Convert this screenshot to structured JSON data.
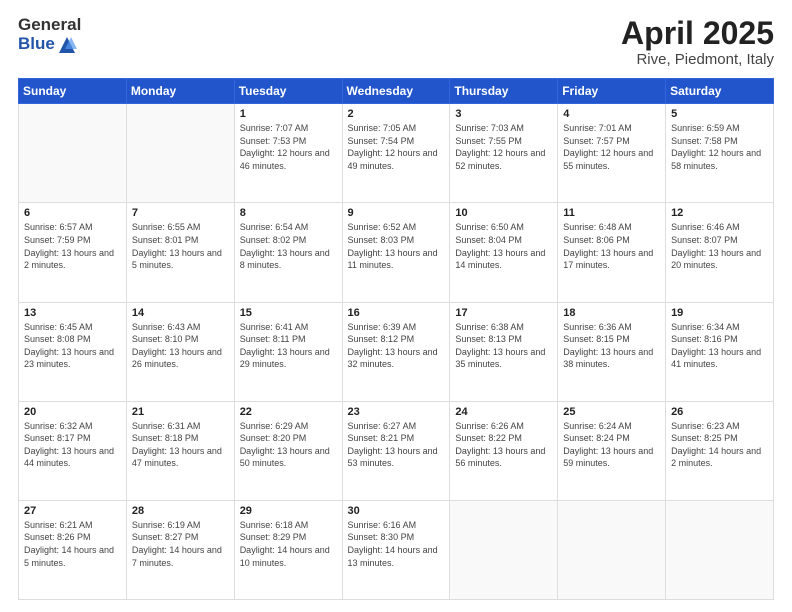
{
  "header": {
    "logo_general": "General",
    "logo_blue": "Blue",
    "title": "April 2025",
    "subtitle": "Rive, Piedmont, Italy"
  },
  "weekdays": [
    "Sunday",
    "Monday",
    "Tuesday",
    "Wednesday",
    "Thursday",
    "Friday",
    "Saturday"
  ],
  "weeks": [
    [
      {
        "day": "",
        "sunrise": "",
        "sunset": "",
        "daylight": ""
      },
      {
        "day": "",
        "sunrise": "",
        "sunset": "",
        "daylight": ""
      },
      {
        "day": "1",
        "sunrise": "Sunrise: 7:07 AM",
        "sunset": "Sunset: 7:53 PM",
        "daylight": "Daylight: 12 hours and 46 minutes."
      },
      {
        "day": "2",
        "sunrise": "Sunrise: 7:05 AM",
        "sunset": "Sunset: 7:54 PM",
        "daylight": "Daylight: 12 hours and 49 minutes."
      },
      {
        "day": "3",
        "sunrise": "Sunrise: 7:03 AM",
        "sunset": "Sunset: 7:55 PM",
        "daylight": "Daylight: 12 hours and 52 minutes."
      },
      {
        "day": "4",
        "sunrise": "Sunrise: 7:01 AM",
        "sunset": "Sunset: 7:57 PM",
        "daylight": "Daylight: 12 hours and 55 minutes."
      },
      {
        "day": "5",
        "sunrise": "Sunrise: 6:59 AM",
        "sunset": "Sunset: 7:58 PM",
        "daylight": "Daylight: 12 hours and 58 minutes."
      }
    ],
    [
      {
        "day": "6",
        "sunrise": "Sunrise: 6:57 AM",
        "sunset": "Sunset: 7:59 PM",
        "daylight": "Daylight: 13 hours and 2 minutes."
      },
      {
        "day": "7",
        "sunrise": "Sunrise: 6:55 AM",
        "sunset": "Sunset: 8:01 PM",
        "daylight": "Daylight: 13 hours and 5 minutes."
      },
      {
        "day": "8",
        "sunrise": "Sunrise: 6:54 AM",
        "sunset": "Sunset: 8:02 PM",
        "daylight": "Daylight: 13 hours and 8 minutes."
      },
      {
        "day": "9",
        "sunrise": "Sunrise: 6:52 AM",
        "sunset": "Sunset: 8:03 PM",
        "daylight": "Daylight: 13 hours and 11 minutes."
      },
      {
        "day": "10",
        "sunrise": "Sunrise: 6:50 AM",
        "sunset": "Sunset: 8:04 PM",
        "daylight": "Daylight: 13 hours and 14 minutes."
      },
      {
        "day": "11",
        "sunrise": "Sunrise: 6:48 AM",
        "sunset": "Sunset: 8:06 PM",
        "daylight": "Daylight: 13 hours and 17 minutes."
      },
      {
        "day": "12",
        "sunrise": "Sunrise: 6:46 AM",
        "sunset": "Sunset: 8:07 PM",
        "daylight": "Daylight: 13 hours and 20 minutes."
      }
    ],
    [
      {
        "day": "13",
        "sunrise": "Sunrise: 6:45 AM",
        "sunset": "Sunset: 8:08 PM",
        "daylight": "Daylight: 13 hours and 23 minutes."
      },
      {
        "day": "14",
        "sunrise": "Sunrise: 6:43 AM",
        "sunset": "Sunset: 8:10 PM",
        "daylight": "Daylight: 13 hours and 26 minutes."
      },
      {
        "day": "15",
        "sunrise": "Sunrise: 6:41 AM",
        "sunset": "Sunset: 8:11 PM",
        "daylight": "Daylight: 13 hours and 29 minutes."
      },
      {
        "day": "16",
        "sunrise": "Sunrise: 6:39 AM",
        "sunset": "Sunset: 8:12 PM",
        "daylight": "Daylight: 13 hours and 32 minutes."
      },
      {
        "day": "17",
        "sunrise": "Sunrise: 6:38 AM",
        "sunset": "Sunset: 8:13 PM",
        "daylight": "Daylight: 13 hours and 35 minutes."
      },
      {
        "day": "18",
        "sunrise": "Sunrise: 6:36 AM",
        "sunset": "Sunset: 8:15 PM",
        "daylight": "Daylight: 13 hours and 38 minutes."
      },
      {
        "day": "19",
        "sunrise": "Sunrise: 6:34 AM",
        "sunset": "Sunset: 8:16 PM",
        "daylight": "Daylight: 13 hours and 41 minutes."
      }
    ],
    [
      {
        "day": "20",
        "sunrise": "Sunrise: 6:32 AM",
        "sunset": "Sunset: 8:17 PM",
        "daylight": "Daylight: 13 hours and 44 minutes."
      },
      {
        "day": "21",
        "sunrise": "Sunrise: 6:31 AM",
        "sunset": "Sunset: 8:18 PM",
        "daylight": "Daylight: 13 hours and 47 minutes."
      },
      {
        "day": "22",
        "sunrise": "Sunrise: 6:29 AM",
        "sunset": "Sunset: 8:20 PM",
        "daylight": "Daylight: 13 hours and 50 minutes."
      },
      {
        "day": "23",
        "sunrise": "Sunrise: 6:27 AM",
        "sunset": "Sunset: 8:21 PM",
        "daylight": "Daylight: 13 hours and 53 minutes."
      },
      {
        "day": "24",
        "sunrise": "Sunrise: 6:26 AM",
        "sunset": "Sunset: 8:22 PM",
        "daylight": "Daylight: 13 hours and 56 minutes."
      },
      {
        "day": "25",
        "sunrise": "Sunrise: 6:24 AM",
        "sunset": "Sunset: 8:24 PM",
        "daylight": "Daylight: 13 hours and 59 minutes."
      },
      {
        "day": "26",
        "sunrise": "Sunrise: 6:23 AM",
        "sunset": "Sunset: 8:25 PM",
        "daylight": "Daylight: 14 hours and 2 minutes."
      }
    ],
    [
      {
        "day": "27",
        "sunrise": "Sunrise: 6:21 AM",
        "sunset": "Sunset: 8:26 PM",
        "daylight": "Daylight: 14 hours and 5 minutes."
      },
      {
        "day": "28",
        "sunrise": "Sunrise: 6:19 AM",
        "sunset": "Sunset: 8:27 PM",
        "daylight": "Daylight: 14 hours and 7 minutes."
      },
      {
        "day": "29",
        "sunrise": "Sunrise: 6:18 AM",
        "sunset": "Sunset: 8:29 PM",
        "daylight": "Daylight: 14 hours and 10 minutes."
      },
      {
        "day": "30",
        "sunrise": "Sunrise: 6:16 AM",
        "sunset": "Sunset: 8:30 PM",
        "daylight": "Daylight: 14 hours and 13 minutes."
      },
      {
        "day": "",
        "sunrise": "",
        "sunset": "",
        "daylight": ""
      },
      {
        "day": "",
        "sunrise": "",
        "sunset": "",
        "daylight": ""
      },
      {
        "day": "",
        "sunrise": "",
        "sunset": "",
        "daylight": ""
      }
    ]
  ]
}
